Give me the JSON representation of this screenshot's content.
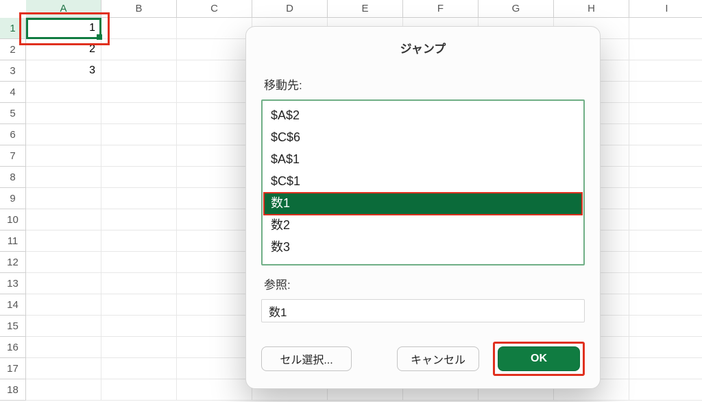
{
  "columns": [
    "A",
    "B",
    "C",
    "D",
    "E",
    "F",
    "G",
    "H",
    "I"
  ],
  "selected_col_index": 0,
  "selected_row_index": 0,
  "row_count": 18,
  "cells": {
    "A1": "1",
    "A2": "2",
    "A3": "3"
  },
  "dialog": {
    "title": "ジャンプ",
    "dest_label": "移動先:",
    "items": [
      "$A$2",
      "$C$6",
      "$A$1",
      "$C$1",
      "数1",
      "数2",
      "数3"
    ],
    "selected_index": 4,
    "ref_label": "参照:",
    "ref_value": "数1",
    "buttons": {
      "special": "セル選択...",
      "cancel": "キャンセル",
      "ok": "OK"
    }
  },
  "colors": {
    "accent": "#107c41",
    "highlight": "#e0301e"
  }
}
